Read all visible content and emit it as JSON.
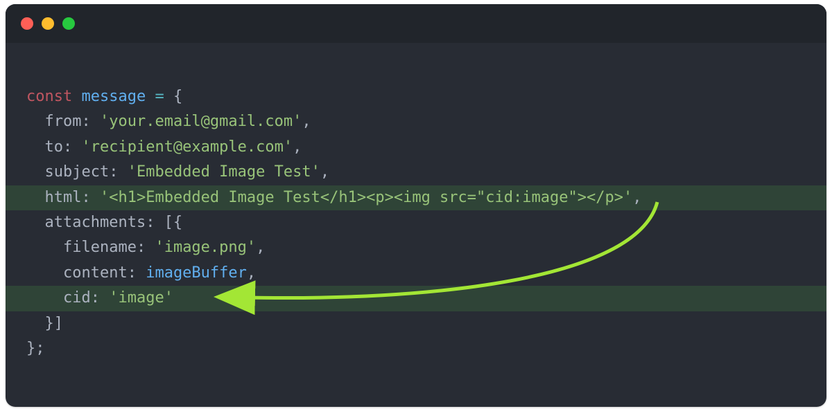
{
  "code": {
    "l1": "const message = {",
    "l1_tokens": {
      "const": "const",
      "space": " ",
      "var": "message",
      "space2": " ",
      "eq": "=",
      "space3": " ",
      "brace": "{"
    },
    "l2": "  from: 'your.email@gmail.com',",
    "l3": "  to: 'recipient@example.com',",
    "l4": "  subject: 'Embedded Image Test',",
    "l5": "  html: '<h1>Embedded Image Test</h1><p><img src=\"cid:image\"></p>',",
    "l6": "  attachments: [{",
    "l7": "    filename: 'image.png',",
    "l8": "    content: imageBuffer,",
    "l9": "    cid: 'image'",
    "l10": "  }]",
    "l11": "};"
  },
  "colors": {
    "arrow": "#a3e635"
  }
}
